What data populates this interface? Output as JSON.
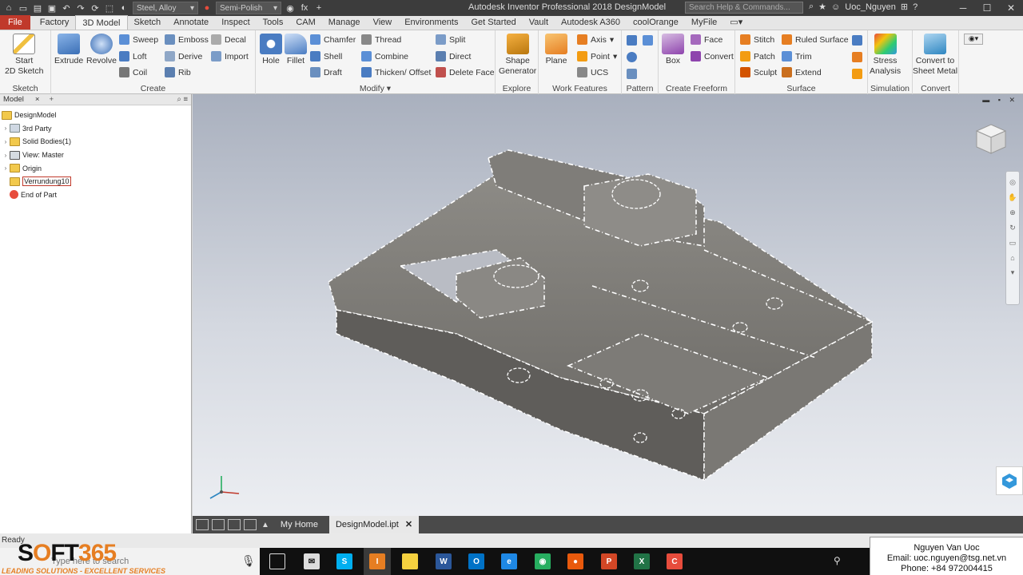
{
  "titlebar": {
    "material": "Steel, Alloy",
    "appearance": "Semi-Polish",
    "title": "Autodesk Inventor Professional 2018    DesignModel",
    "search_placeholder": "Search Help & Commands...",
    "user": "Uoc_Nguyen"
  },
  "tabs": [
    "File",
    "Factory",
    "3D Model",
    "Sketch",
    "Annotate",
    "Inspect",
    "Tools",
    "CAM",
    "Manage",
    "View",
    "Environments",
    "Get Started",
    "Vault",
    "Autodesk A360",
    "coolOrange",
    "MyFile"
  ],
  "ribbon": {
    "sketch": {
      "label": "Sketch",
      "start": "Start",
      "start2": "2D Sketch"
    },
    "create": {
      "label": "Create",
      "extrude": "Extrude",
      "revolve": "Revolve",
      "sweep": "Sweep",
      "loft": "Loft",
      "coil": "Coil",
      "emboss": "Emboss",
      "derive": "Derive",
      "rib": "Rib",
      "decal": "Decal",
      "import": "Import"
    },
    "modify": {
      "label": "Modify",
      "hole": "Hole",
      "fillet": "Fillet",
      "chamfer": "Chamfer",
      "shell": "Shell",
      "draft": "Draft",
      "thread": "Thread",
      "combine": "Combine",
      "thicken": "Thicken/ Offset",
      "split": "Split",
      "direct": "Direct",
      "delete_face": "Delete Face"
    },
    "explore": {
      "label": "Explore",
      "shape": "Shape",
      "shape2": "Generator"
    },
    "work": {
      "label": "Work Features",
      "plane": "Plane",
      "axis": "Axis",
      "point": "Point",
      "ucs": "UCS"
    },
    "pattern": {
      "label": "Pattern"
    },
    "freeform": {
      "label": "Create Freeform",
      "box": "Box",
      "face": "Face",
      "convert": "Convert"
    },
    "surface": {
      "label": "Surface",
      "stitch": "Stitch",
      "patch": "Patch",
      "sculpt": "Sculpt",
      "ruled": "Ruled Surface",
      "trim": "Trim",
      "extend": "Extend"
    },
    "simulation": {
      "label": "Simulation",
      "stress": "Stress",
      "stress2": "Analysis"
    },
    "convert": {
      "label": "Convert",
      "sheet": "Convert to",
      "sheet2": "Sheet Metal"
    }
  },
  "browser": {
    "tab": "Model",
    "close": "×",
    "add": "+",
    "nodes": [
      {
        "label": "DesignModel"
      },
      {
        "label": "3rd Party"
      },
      {
        "label": "Solid Bodies(1)"
      },
      {
        "label": "View: Master"
      },
      {
        "label": "Origin"
      },
      {
        "label": "Verrundung10"
      },
      {
        "label": "End of Part"
      }
    ]
  },
  "doctabs": {
    "home": "My Home",
    "doc": "DesignModel.ipt",
    "close": "✕"
  },
  "status": "Ready",
  "taskbar": {
    "search": "Type here to search"
  },
  "logo": {
    "s": "S",
    "o": "O",
    "ft": "FT",
    "num": "365",
    "tagline": "LEADING SOLUTIONS - EXCELLENT SERVICES"
  },
  "contact": {
    "name": "Nguyen Van Uoc",
    "email": "Email: uoc.nguyen@tsg.net.vn",
    "phone": "Phone: +84 972004415"
  },
  "colors": {
    "file_tab": "#c0392b",
    "accent": "#e67e22",
    "part": "#8a8883"
  }
}
